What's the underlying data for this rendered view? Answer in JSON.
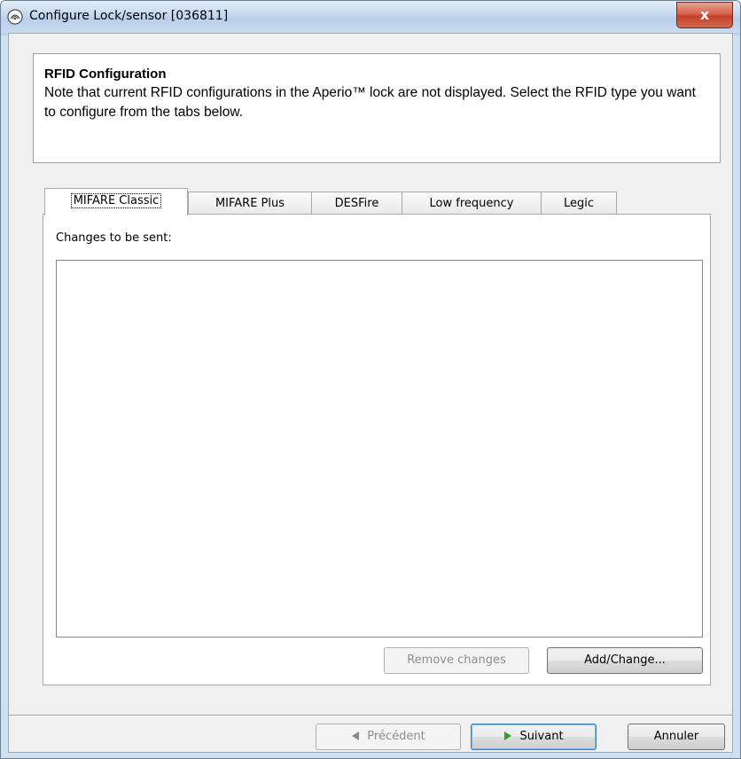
{
  "window": {
    "title": "Configure Lock/sensor [036811]",
    "close_label": "x"
  },
  "header": {
    "title": "RFID Configuration",
    "description": "Note that current RFID configurations in the Aperio™ lock are not displayed. Select the RFID type you want to configure from the tabs below."
  },
  "tabs": [
    {
      "label": "MIFARE Classic",
      "active": true
    },
    {
      "label": "MIFARE Plus",
      "active": false
    },
    {
      "label": "DESFire",
      "active": false
    },
    {
      "label": "Low frequency",
      "active": false
    },
    {
      "label": "Legic",
      "active": false
    }
  ],
  "panel": {
    "changes_label": "Changes to be sent:",
    "changes_items": [],
    "remove_label": "Remove changes",
    "add_label": "Add/Change..."
  },
  "footer": {
    "previous_label": "Précédent",
    "next_label": "Suivant",
    "cancel_label": "Annuler"
  },
  "colors": {
    "next_arrow": "#2ea31f",
    "previous_arrow": "#8a8a8a",
    "close_button": "#c5402a"
  },
  "icons": {
    "title": "aperio-logo-icon",
    "previous": "triangle-left-icon",
    "next": "triangle-right-icon"
  }
}
